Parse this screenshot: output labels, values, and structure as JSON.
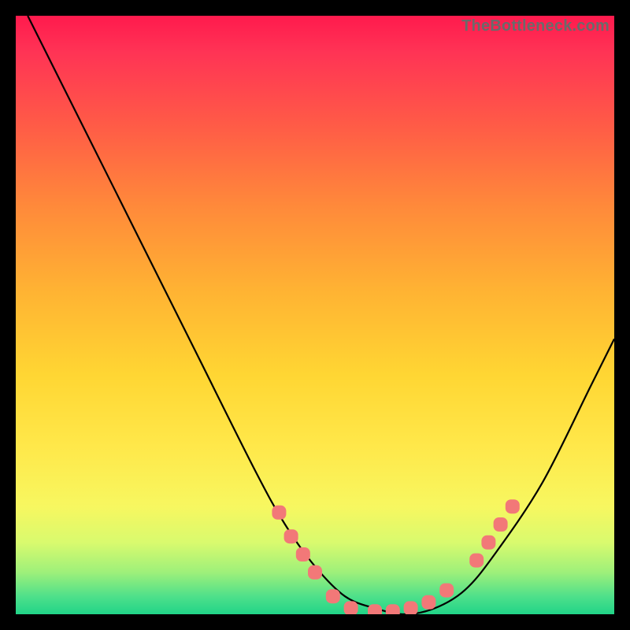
{
  "watermark": "TheBottleneck.com",
  "chart_data": {
    "type": "line",
    "title": "",
    "xlabel": "",
    "ylabel": "",
    "xlim": [
      0,
      100
    ],
    "ylim": [
      0,
      100
    ],
    "grid": false,
    "series": [
      {
        "name": "bottleneck-curve",
        "x": [
          2,
          10,
          20,
          30,
          40,
          45,
          50,
          55,
          60,
          65,
          70,
          75,
          80,
          88,
          96,
          100
        ],
        "values": [
          100,
          84,
          64,
          44,
          24,
          15,
          8,
          3,
          1,
          0,
          1,
          4,
          10,
          22,
          38,
          46
        ]
      }
    ],
    "markers": {
      "name": "highlight-dots",
      "color": "#f27878",
      "points": [
        {
          "x": 44,
          "y": 17
        },
        {
          "x": 46,
          "y": 13
        },
        {
          "x": 48,
          "y": 10
        },
        {
          "x": 50,
          "y": 7
        },
        {
          "x": 53,
          "y": 3
        },
        {
          "x": 56,
          "y": 1
        },
        {
          "x": 60,
          "y": 0.5
        },
        {
          "x": 63,
          "y": 0.5
        },
        {
          "x": 66,
          "y": 1
        },
        {
          "x": 69,
          "y": 2
        },
        {
          "x": 72,
          "y": 4
        },
        {
          "x": 77,
          "y": 9
        },
        {
          "x": 79,
          "y": 12
        },
        {
          "x": 81,
          "y": 15
        },
        {
          "x": 83,
          "y": 18
        }
      ]
    }
  }
}
